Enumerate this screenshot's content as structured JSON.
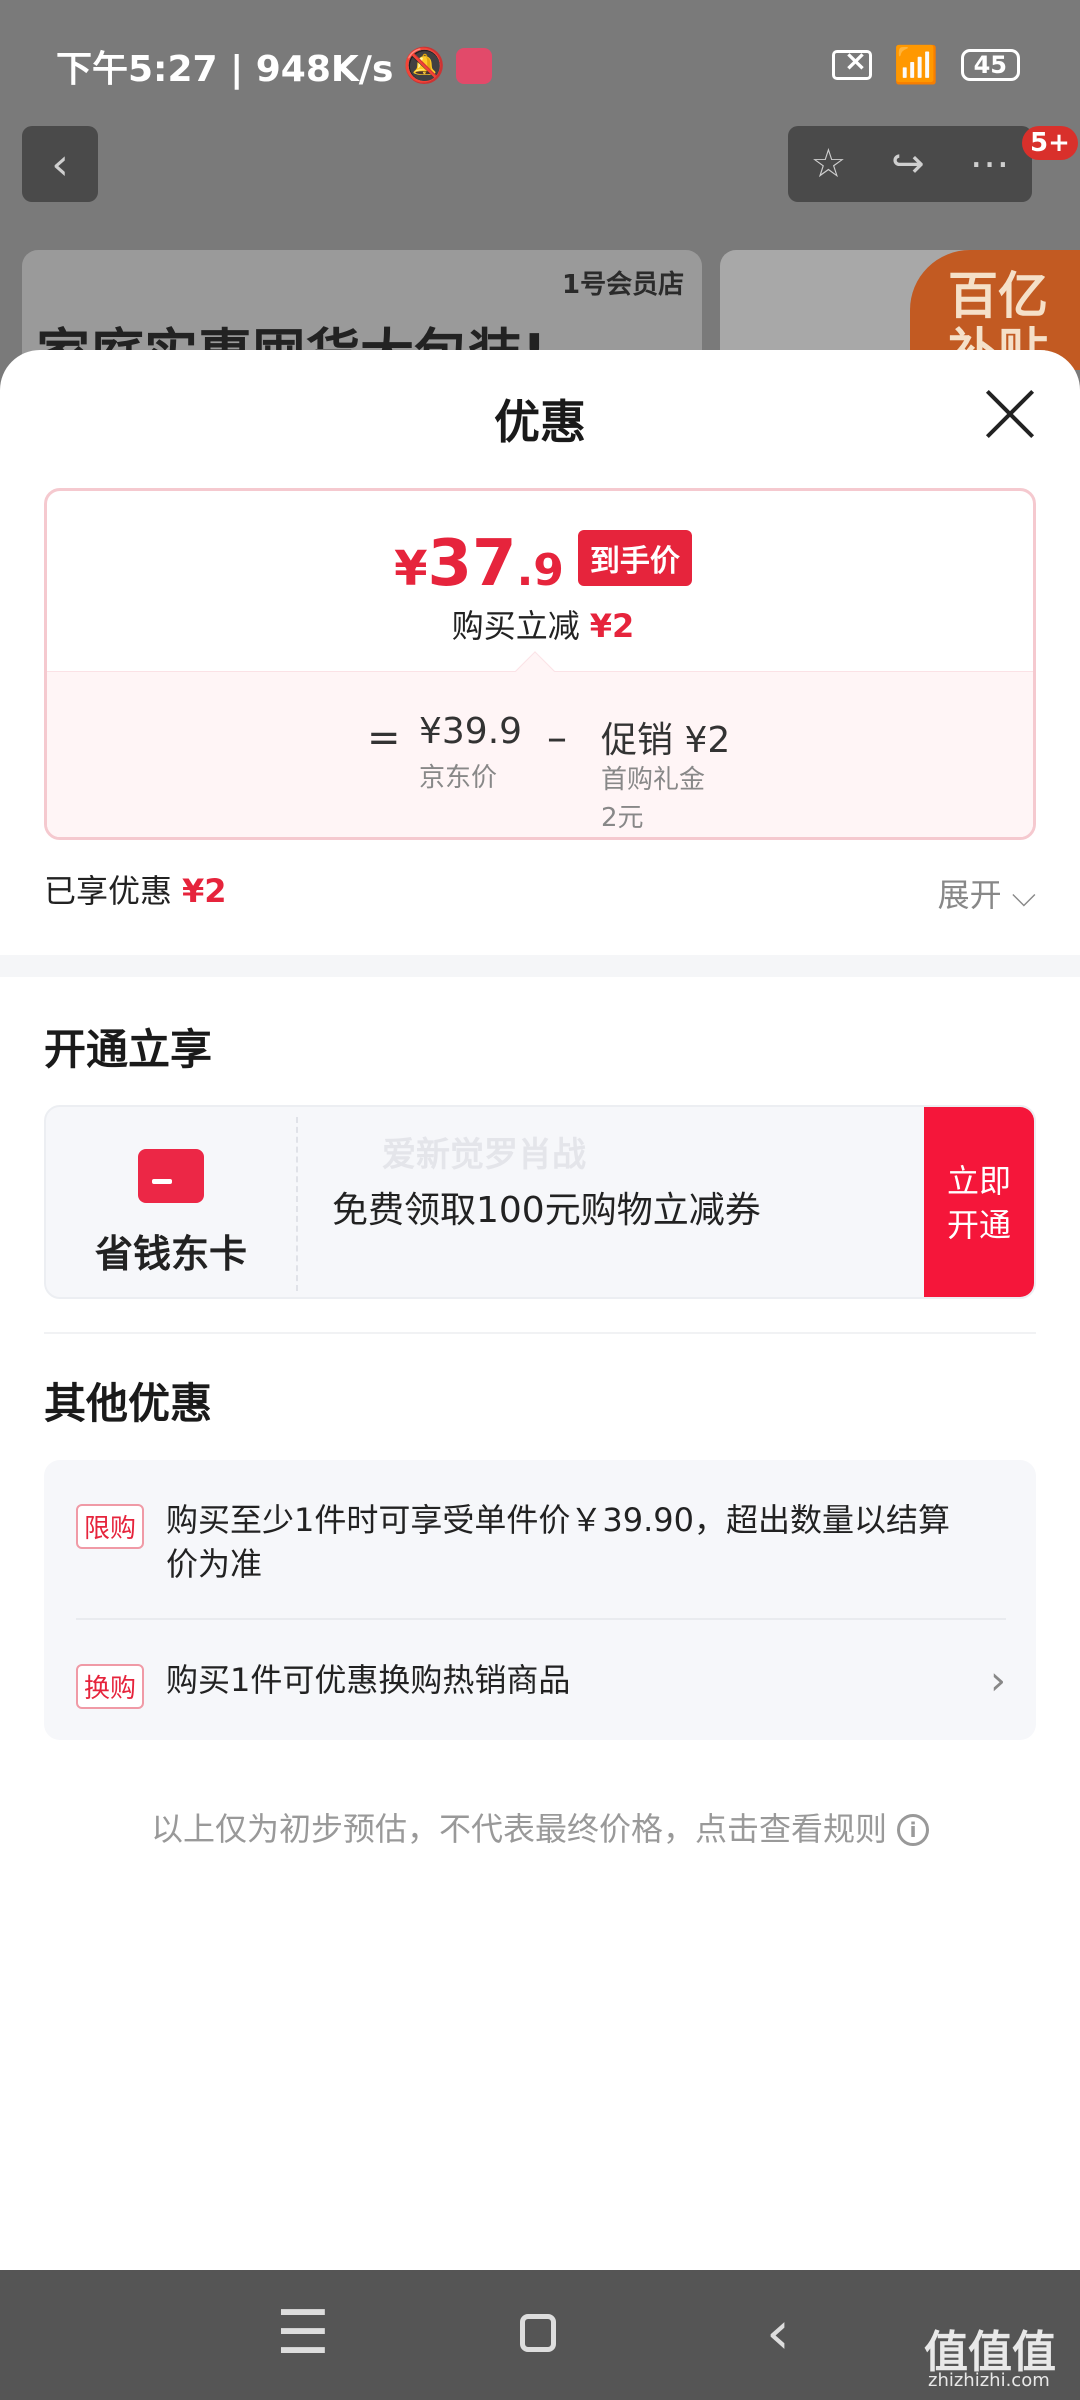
{
  "status_bar": {
    "time_speed": "下午5:27 | 948K/s",
    "battery": "45"
  },
  "top_bar": {
    "back_icon": "chevron-left-icon",
    "actions": [
      "star-icon",
      "share-icon",
      "more-icon"
    ],
    "badge": "5+"
  },
  "banner": {
    "logo_text": "1号会员店",
    "title": "家庭实惠囤货大包装!",
    "subsidy_text_1": "百亿",
    "subsidy_text_2": "补贴"
  },
  "sheet": {
    "title": "优惠",
    "close_icon": "close-icon"
  },
  "price": {
    "yen": "¥",
    "int": "37",
    "dec": ".9",
    "tag": "到手价",
    "reduce_label": "购买立减",
    "reduce_value": "¥2",
    "eq": "=",
    "base_price": "¥39.9",
    "base_label": "京东价",
    "minus": "–",
    "promo": "促销 ¥2",
    "promo_sub_1": "首购礼金",
    "promo_sub_2": "2元"
  },
  "enjoyed": {
    "label": "已享优惠",
    "value": "¥2",
    "expand": "展开 ⌵"
  },
  "open_section": {
    "title": "开通立享",
    "card_name": "省钱东卡",
    "desc": "免费领取100元购物立减券",
    "watermark": "爱新觉罗肖战",
    "button_line_1": "立即",
    "button_line_2": "开通",
    "card_icon": "card-icon"
  },
  "other_section": {
    "title": "其他优惠",
    "rows": [
      {
        "chip": "限购",
        "text": "购买至少1件时可享受单件价￥39.90，超出数量以结算价为准"
      },
      {
        "chip": "换购",
        "text": "购买1件可优惠换购热销商品"
      }
    ]
  },
  "note": {
    "text": "以上仅为初步预估，不代表最终价格，点击查看规则",
    "icon": "i"
  },
  "navbar": {
    "menu_icon": "menu-icon",
    "home_icon": "home-icon",
    "back_icon": "back-icon"
  },
  "watermark": {
    "logo": "值值值",
    "url": "zhizhizhi.com"
  }
}
